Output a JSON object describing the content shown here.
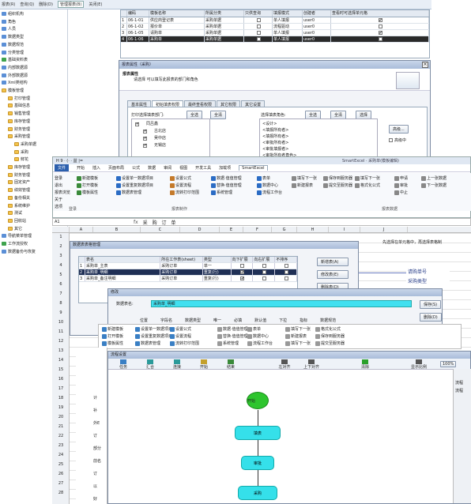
{
  "top_menu": [
    "报表(R)",
    "查询(Q)",
    "删除(D)",
    "管理报表(B)",
    "关闭(E)"
  ],
  "tree": [
    {
      "label": "组织机构",
      "icon": "blue"
    },
    {
      "label": "角色",
      "icon": "blue"
    },
    {
      "label": "人员",
      "icon": "blue"
    },
    {
      "label": "数据类型",
      "icon": "blue"
    },
    {
      "label": "数据规范",
      "icon": "blue"
    },
    {
      "label": "分类管理",
      "icon": "blue"
    },
    {
      "label": "基础资料表",
      "icon": "green"
    },
    {
      "label": "内部数据源",
      "icon": "blue"
    },
    {
      "label": "外部数据源",
      "icon": "blue"
    },
    {
      "label": "Xml类结构",
      "icon": "blue"
    },
    {
      "label": "模板管理",
      "icon": "folder"
    },
    {
      "label": "打印管理",
      "icon": "folder"
    },
    {
      "label": "基础信息",
      "icon": "folder"
    },
    {
      "label": "销售管理",
      "icon": "folder"
    },
    {
      "label": "库存管理",
      "icon": "folder"
    },
    {
      "label": "财务管理",
      "icon": "folder"
    },
    {
      "label": "采购管理",
      "icon": "folder"
    },
    {
      "label": "采购单据",
      "icon": "folder"
    },
    {
      "label": "采购",
      "icon": "folder"
    },
    {
      "label": "鲜花",
      "icon": "folder"
    },
    {
      "label": "库存管理",
      "icon": "folder"
    },
    {
      "label": "财务管理",
      "icon": "folder"
    },
    {
      "label": "固定资产",
      "icon": "folder"
    },
    {
      "label": "绩效管理",
      "icon": "folder"
    },
    {
      "label": "备份相关",
      "icon": "folder"
    },
    {
      "label": "系统维护",
      "icon": "folder"
    },
    {
      "label": "测试",
      "icon": "folder"
    },
    {
      "label": "回收站",
      "icon": "folder"
    },
    {
      "label": "其它",
      "icon": "folder"
    },
    {
      "label": "导航菜单管理",
      "icon": "blue"
    },
    {
      "label": "工作流授权",
      "icon": "green"
    },
    {
      "label": "数据备份与恢复",
      "icon": "blue"
    }
  ],
  "grid1": {
    "headers": [
      "",
      "编码",
      "模板名称",
      "所属分类",
      "只供查询",
      "填报模式",
      "创建者",
      "查看时可选择单元格"
    ],
    "rows": [
      {
        "n": "1",
        "code": "06-1-01",
        "name": "供应商登记表",
        "cat": "采购单据",
        "q": false,
        "mode": "单人填报",
        "creator": "user0",
        "sel": true
      },
      {
        "n": "2",
        "code": "06-1-02",
        "name": "报价单",
        "cat": "采购单据",
        "q": false,
        "mode": "流程驱动",
        "creator": "user0",
        "sel": false
      },
      {
        "n": "3",
        "code": "06-1-05",
        "name": "请购单",
        "cat": "采购单据",
        "q": false,
        "mode": "单人填报",
        "creator": "user0",
        "sel": true
      },
      {
        "n": "4",
        "code": "06-1-06",
        "name": "采购单",
        "cat": "采购单据",
        "q": false,
        "mode": "单人填报",
        "creator": "user0",
        "sel": false
      }
    ]
  },
  "dlg1": {
    "title": "报表属性（采购）",
    "heading": "报表属性",
    "desc": "请选择 可以填写此报表的部门和角色",
    "tabs": [
      "基本属性",
      "初始填表权限",
      "最终查看权限",
      "其它权限",
      "其它设置"
    ],
    "dept_label": "打印选择填表部门:",
    "role_label": "选择填表角色:",
    "btn_all": "全选",
    "btn_none": "全清",
    "btn_pick": "选择",
    "dept_items": [
      "同吕鑫",
      "古北店",
      "吴中店",
      "无锡店"
    ],
    "role_items": [
      "<设计>",
      "<填报所有者>",
      "<填报所有者>",
      "<审批所有者>",
      "<审批填报者>",
      "<审批所有者角色>"
    ],
    "btn_advanced": "高级...",
    "chk_advanced": "高级中"
  },
  "ribbon": {
    "qa": "H 9 · (· · 益 |=",
    "tabs": [
      "文件",
      "开始",
      "插入",
      "页面布局",
      "公式",
      "数据",
      "审阅",
      "视图",
      "开发工具",
      "加载项",
      "SmartExcel"
    ],
    "title": "SmartExcel ·  采购单(模板编辑)",
    "items_col1": [
      "登录",
      "退出",
      "报表浏览",
      "关于",
      "选项"
    ],
    "items_col2": [
      "新建模板",
      "打开模板",
      "模板属性"
    ],
    "items_col3": [
      "设置单一数据项目",
      "设置重复数据项目",
      "数据表管理"
    ],
    "items_col4": [
      "设置公式",
      "设置流程",
      "流转打印范围"
    ],
    "items_col5": [
      "数据·值值管理",
      "替换·值值管理",
      "系统管理"
    ],
    "items_col6": [
      "表单",
      "数据中心",
      "流程工作台"
    ],
    "items_col7": [
      "填写下一张",
      "新建报表"
    ],
    "items_col8": [
      "保存到服务器",
      "提交至服务器"
    ],
    "items_col9": [
      "填写下一张",
      "格式化公式"
    ],
    "items_col10": [
      "申请",
      "审批",
      "中止"
    ],
    "items_col11": [
      "上一张数据",
      "下一张数据"
    ],
    "group_labels": [
      "登录",
      "报表制作",
      "报表数据"
    ]
  },
  "formula": {
    "cell": "A1",
    "text": "采 购 订 单"
  },
  "cols": [
    "A",
    "B",
    "C",
    "D",
    "E",
    "F",
    "G",
    "H",
    "I",
    "J"
  ],
  "rows": [
    "1",
    "2",
    "3",
    "4",
    "5",
    "6",
    "7",
    "8",
    "9",
    "10",
    "11",
    "12",
    "13",
    "14",
    "15",
    "16",
    "17",
    "18",
    "19",
    "20",
    "21",
    "22",
    "23",
    "24",
    "25",
    "26",
    "27",
    "28"
  ],
  "dlg2": {
    "title": "数据表表格管理",
    "headers": [
      "表名",
      "所在工作表(sheet)",
      "类型",
      "向下扩展",
      "向右扩展",
      "不排序"
    ],
    "rows": [
      {
        "n": "1",
        "name": "采购单_主表",
        "sheet": "采购订单",
        "type": "单一"
      },
      {
        "n": "2",
        "name": "采购单_明细",
        "sheet": "采购订单",
        "type": "重复(行)"
      },
      {
        "n": "3",
        "name": "采购单_备注明细",
        "sheet": "采购订单",
        "type": "重复(行)"
      }
    ],
    "buttons": [
      "新增表(A)",
      "修改表(E)",
      "删除表(D)"
    ],
    "note": "先选择在单元格中，再选择表格制"
  },
  "popup": {
    "line1": "请购单号",
    "line2": "采购类型"
  },
  "dlg3": {
    "title": "修改",
    "label": "数据表名:",
    "value": "采购单_明细",
    "headers": [
      "位置",
      "字段名",
      "数据类型",
      "唯一",
      "必填",
      "默认值",
      "下拉",
      "指标",
      "数据规范"
    ],
    "btn_save": "保存(S)",
    "btn_delete": "删除(D)"
  },
  "rib2": {
    "items": [
      "新建模板",
      "打开模板",
      "模板属性",
      "设置单一数据项目",
      "设置重复数据项目",
      "数据表管理",
      "设置公式",
      "设置流程",
      "流转打印范围",
      "数据·值值管理",
      "替换·值值管理",
      "系统管理",
      "表单",
      "数据中心",
      "流程工作台",
      "填写下一张",
      "新建报表",
      "填写下一张",
      "格式化公式",
      "保存到服务器",
      "提交至服务器"
    ]
  },
  "flow": {
    "title": "流程设置",
    "toolbar": [
      "任务",
      "汇合",
      "连接",
      "开始",
      "结束",
      "",
      "左对齐",
      "上下对齐",
      "",
      "清除",
      "",
      "显示比例"
    ],
    "zoom": "100%",
    "nodes": [
      "开始",
      "填表",
      "审批",
      "采购"
    ],
    "right_labels": [
      "流程",
      "流程"
    ]
  },
  "leftstrip": [
    "计",
    "补",
    "外E",
    "订",
    "部分",
    "前名",
    "订",
    "以",
    "好"
  ]
}
